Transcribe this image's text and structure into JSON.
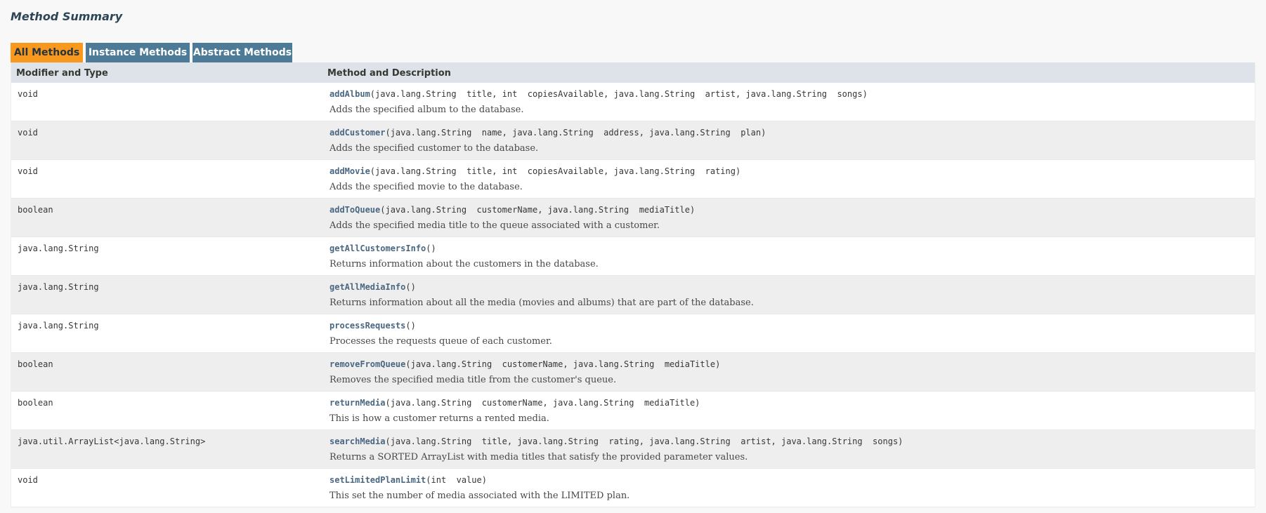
{
  "heading": "Method Summary",
  "tabs": [
    "All Methods",
    "Instance Methods",
    "Abstract Methods"
  ],
  "table": {
    "headers": [
      "Modifier and Type",
      "Method and Description"
    ],
    "rows": [
      {
        "type": "void",
        "name": "addAlbum",
        "params": "(java.lang.String  title, int  copiesAvailable, java.lang.String  artist, java.lang.String  songs)",
        "desc": "Adds the specified album to the database."
      },
      {
        "type": "void",
        "name": "addCustomer",
        "params": "(java.lang.String  name, java.lang.String  address, java.lang.String  plan)",
        "desc": "Adds the specified customer to the database."
      },
      {
        "type": "void",
        "name": "addMovie",
        "params": "(java.lang.String  title, int  copiesAvailable, java.lang.String  rating)",
        "desc": "Adds the specified movie to the database."
      },
      {
        "type": "boolean",
        "name": "addToQueue",
        "params": "(java.lang.String  customerName, java.lang.String  mediaTitle)",
        "desc": "Adds the specified media title to the queue associated with a customer."
      },
      {
        "type": "java.lang.String",
        "name": "getAllCustomersInfo",
        "params": "()",
        "desc": "Returns information about the customers in the database."
      },
      {
        "type": "java.lang.String",
        "name": "getAllMediaInfo",
        "params": "()",
        "desc": "Returns information about all the media (movies and albums) that are part of the database."
      },
      {
        "type": "java.lang.String",
        "name": "processRequests",
        "params": "()",
        "desc": "Processes the requests queue of each customer."
      },
      {
        "type": "boolean",
        "name": "removeFromQueue",
        "params": "(java.lang.String  customerName, java.lang.String  mediaTitle)",
        "desc": "Removes the specified media title from the customer's queue."
      },
      {
        "type": "boolean",
        "name": "returnMedia",
        "params": "(java.lang.String  customerName, java.lang.String  mediaTitle)",
        "desc": "This is how a customer returns a rented media."
      },
      {
        "type": "java.util.ArrayList<java.lang.String>",
        "name": "searchMedia",
        "params": "(java.lang.String  title, java.lang.String  rating, java.lang.String  artist, java.lang.String  songs)",
        "desc": "Returns a SORTED ArrayList with media titles that satisfy the provided parameter values."
      },
      {
        "type": "void",
        "name": "setLimitedPlanLimit",
        "params": "(int  value)",
        "desc": "This set the number of media associated with the LIMITED plan."
      }
    ]
  },
  "colors": {
    "active_tab": "#f8981d",
    "inactive_tab": "#4d7a97",
    "header_bg": "#dee3e9",
    "link": "#4a6782"
  }
}
